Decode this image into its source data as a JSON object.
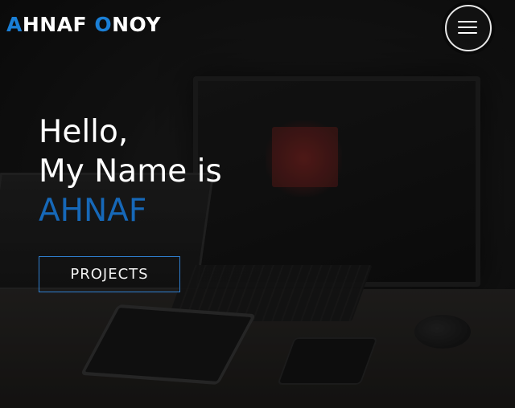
{
  "brand": {
    "first_initial": "A",
    "first_rest": "HNAF ",
    "last_initial": "O",
    "last_rest": "NOY",
    "accent_color": "#1a7fd6"
  },
  "nav": {
    "menu_icon": "hamburger-menu-icon"
  },
  "hero": {
    "line1": "Hello,",
    "line2": "My Name is",
    "name": "AHNAF",
    "name_color": "#1668b8",
    "background": "dark desk scene with computer monitor, laptop, keyboard, tablet, phone and mouse"
  },
  "cta": {
    "label": "PROJECTS",
    "border_color": "#2f7fd0"
  }
}
